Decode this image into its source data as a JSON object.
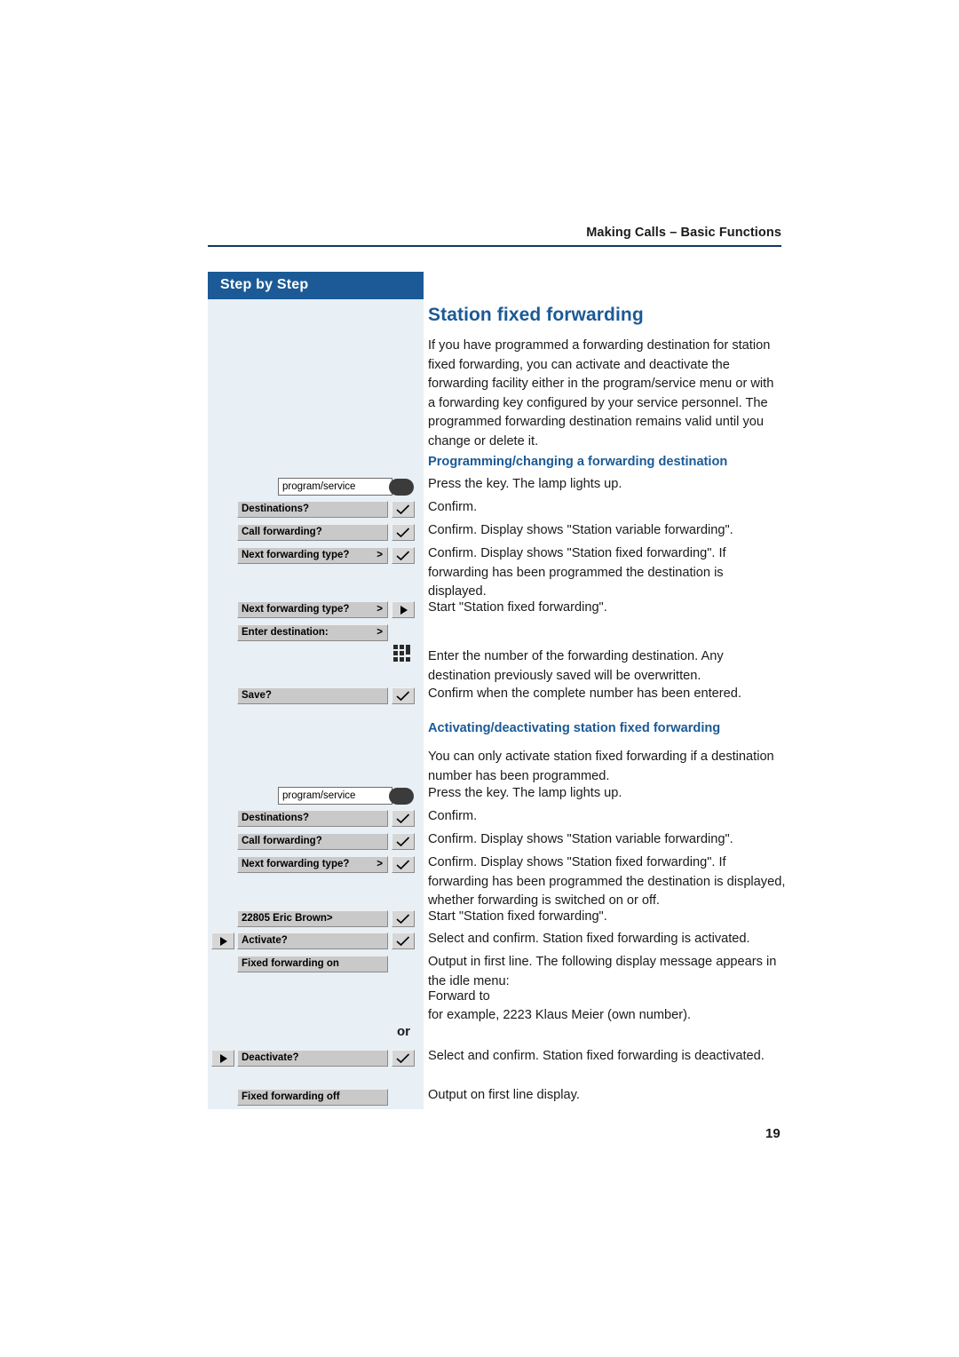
{
  "header": {
    "running_head": "Making Calls – Basic Functions",
    "page_number": "19"
  },
  "sidebar": {
    "title": "Step by Step"
  },
  "main": {
    "title": "Station fixed forwarding",
    "intro": "If you have programmed a forwarding destination for station fixed forwarding, you can activate and deactivate the forwarding facility either in the program/service menu or with a forwarding key configured by your service personnel. The programmed forwarding destination remains valid until you change or delete it.",
    "section1_heading": "Programming/changing a forwarding destination",
    "section2_heading": "Activating/deactivating station fixed forwarding",
    "or_label": "or",
    "steps1": [
      "Press the key. The lamp lights up.",
      "Confirm.",
      "Confirm. Display shows \"Station variable forwarding\".",
      "Confirm. Display shows \"Station fixed forwarding\". If forwarding has been programmed the destination is displayed.",
      "Start \"Station fixed forwarding\".",
      "Enter the number of the forwarding destination. Any destination previously saved will be overwritten.",
      "Confirm when the complete number has been entered."
    ],
    "section2_intro": "You can only activate station fixed forwarding if a destination number has been programmed.",
    "steps2": [
      "Press the key. The lamp lights up.",
      "Confirm.",
      "Confirm. Display shows \"Station variable forwarding\".",
      "Confirm. Display shows \"Station fixed forwarding\". If forwarding has been programmed the destination is displayed, whether forwarding is switched on or off.",
      "Start \"Station fixed forwarding\".",
      "Select and confirm. Station fixed forwarding is activated.",
      "Output in first line. The following display message appears in the idle menu:",
      "Forward to",
      "for example, 2223 Klaus Meier (own number).",
      "Select and confirm. Station fixed forwarding is deactivated.",
      "Output on first line display."
    ]
  },
  "keys": {
    "program_service": "program/service",
    "destinations": "Destinations?",
    "call_forwarding": "Call forwarding?",
    "next_forwarding_type": "Next forwarding type?",
    "next_forwarding_arrow": ">",
    "enter_destination": "Enter destination:",
    "enter_destination_arrow": ">",
    "save": "Save?",
    "contact": "22805 Eric Brown>",
    "activate": "Activate?",
    "fixed_forwarding_on": "Fixed forwarding on",
    "deactivate": "Deactivate?",
    "fixed_forwarding_off": "Fixed forwarding off"
  },
  "icons": {
    "ok": "checkmark-icon",
    "right_arrow": "right-arrow-icon",
    "left_arrow": "left-arrow-icon",
    "keypad": "keypad-icon",
    "lamp": "lamp-icon"
  },
  "colors": {
    "accent_blue": "#1b5a96",
    "panel_blue": "#e8eff5",
    "rule_blue": "#15355e"
  }
}
